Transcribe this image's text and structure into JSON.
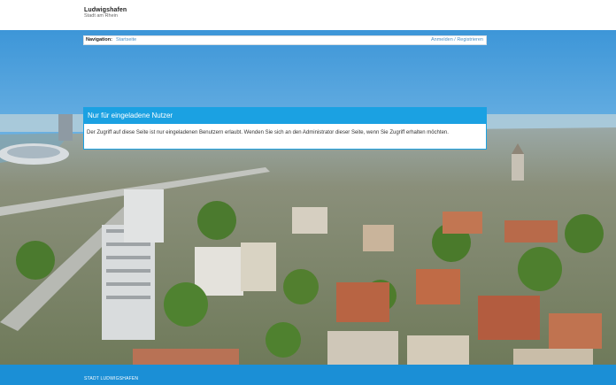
{
  "header": {
    "logo_title": "Ludwigshafen",
    "logo_subtitle": "Stadt am Rhein"
  },
  "nav": {
    "label": "Navigation:",
    "home_link": "Startseite",
    "auth_link": "Anmelden / Registrieren"
  },
  "notice": {
    "title": "Nur für eingeladene Nutzer",
    "body": "Der Zugriff auf diese Seite ist nur eingeladenen Benutzern erlaubt. Wenden Sie sich an den Administrator dieser Seite, wenn Sie Zugriff erhalten möchten."
  },
  "footer": {
    "text": "STADT LUDWIGSHAFEN"
  },
  "colors": {
    "accent": "#1ba1e2",
    "footer": "#1b8fd6",
    "link": "#4a8fc4"
  }
}
